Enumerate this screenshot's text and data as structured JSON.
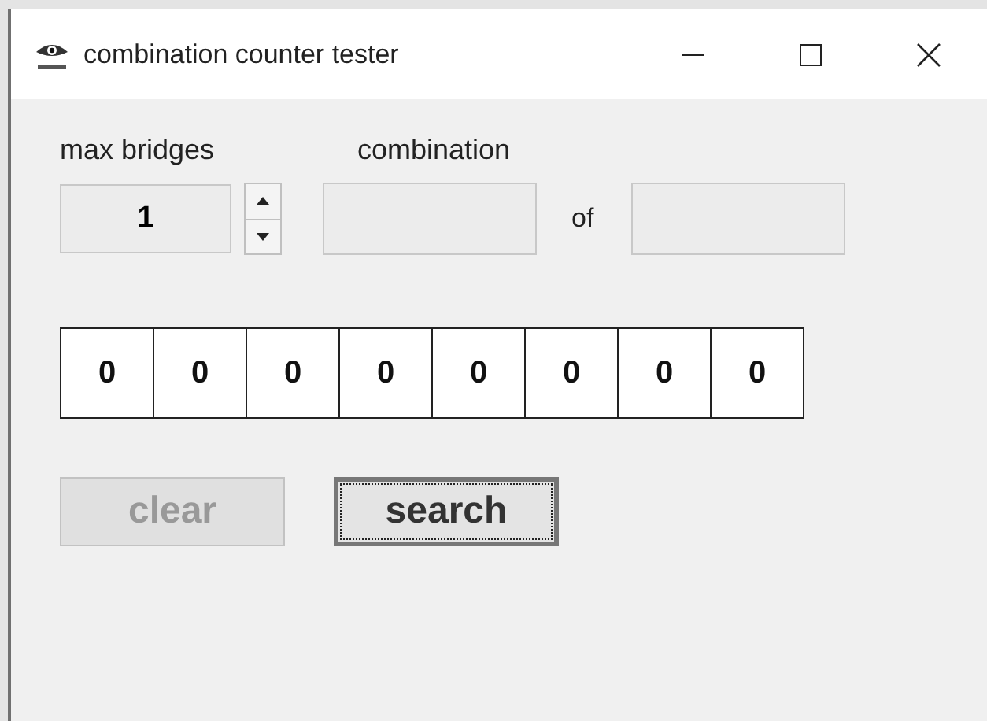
{
  "window": {
    "title": "combination counter tester"
  },
  "max_bridges": {
    "label": "max bridges",
    "value": "1"
  },
  "combination": {
    "label": "combination",
    "separator": "of"
  },
  "digits": [
    "0",
    "0",
    "0",
    "0",
    "0",
    "0",
    "0",
    "0"
  ],
  "buttons": [
    {
      "label": "clear",
      "disabled": true,
      "focused": false
    },
    {
      "label": "search",
      "disabled": false,
      "focused": true
    }
  ]
}
